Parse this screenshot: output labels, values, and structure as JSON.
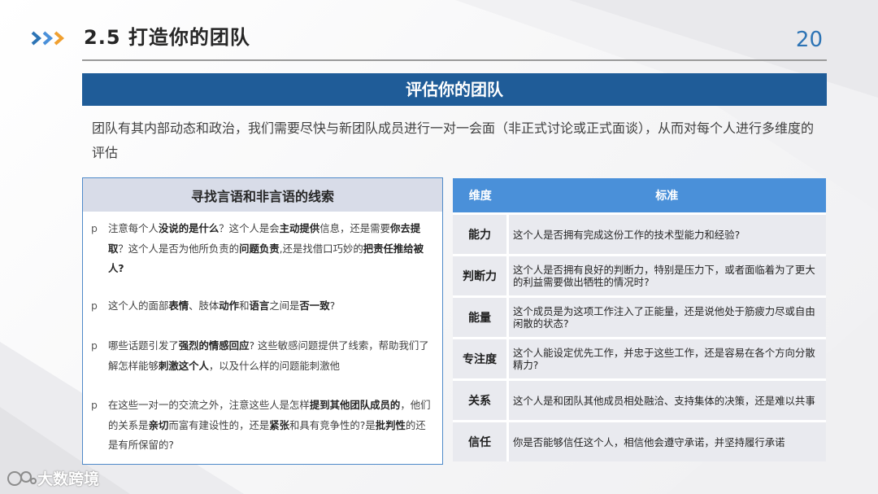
{
  "header": {
    "title": "2.5 打造你的团队",
    "page_number": "20",
    "chevron_icon": "triple-chevron-right-icon",
    "chevron_colors": [
      "#2d74b5",
      "#4a90d9",
      "#f0a030"
    ]
  },
  "section_title": "评估你的团队",
  "intro_text": "团队有其内部动态和政治，我们需要尽快与新团队成员进行一对一会面（非正式讨论或正式面谈），从而对每个人进行多维度的评估",
  "left_panel": {
    "heading": "寻找言语和非言语的线索",
    "bullet_marker": "p",
    "bullets": [
      [
        "注意每个人",
        "没说的是什么",
        "？这个人是会",
        "主动提供",
        "信息，还是需要",
        "你去提取",
        "？这个人是否为他所负责的",
        "问题负责",
        ",还是找借口巧妙的",
        "把责任推给被人?"
      ],
      [
        "这个人的面部",
        "表情",
        "、肢体",
        "动作",
        "和",
        "语言",
        "之间是",
        "否一致",
        "?"
      ],
      [
        "哪些话题引发了",
        "强烈的情感回应",
        "? 这些敏感问题提供了线索，帮助我们了解怎样能够",
        "刺激这个人",
        "，以及什么样的问题能刺激他"
      ],
      [
        "在这些一对一的交流之外，注意这些人是怎样",
        "提到其他团队成员的",
        "，他们的关系是",
        "亲切",
        "而富有建设性的，还是",
        "紧张",
        "和具有竞争性的?是",
        "批判性",
        "的还是有所保留的?"
      ]
    ]
  },
  "table": {
    "headers": [
      "维度",
      "标准"
    ],
    "rows": [
      {
        "dimension": "能力",
        "standard": "这个人是否拥有完成这份工作的技术型能力和经验?"
      },
      {
        "dimension": "判断力",
        "standard": "这个人是否拥有良好的判断力，特别是压力下，或者面临着为了更大的利益需要做出牺牲的情况时?"
      },
      {
        "dimension": "能量",
        "standard": "这个成员是为这项工作注入了正能量，还是说他处于筋疲力尽或自由闲散的状态?"
      },
      {
        "dimension": "专注度",
        "standard": "这个人能设定优先工作，并忠于这些工作，还是容易在各个方向分散精力?"
      },
      {
        "dimension": "关系",
        "standard": "这个人是和团队其他成员相处融洽、支持集体的决策，还是难以共事"
      },
      {
        "dimension": "信任",
        "standard": "你是否能够信任这个人，相信他会遵守承诺，并坚持履行承诺"
      }
    ]
  },
  "footer": {
    "logo_text": "大数跨境",
    "logo_icon": "brand-logo-icon"
  }
}
